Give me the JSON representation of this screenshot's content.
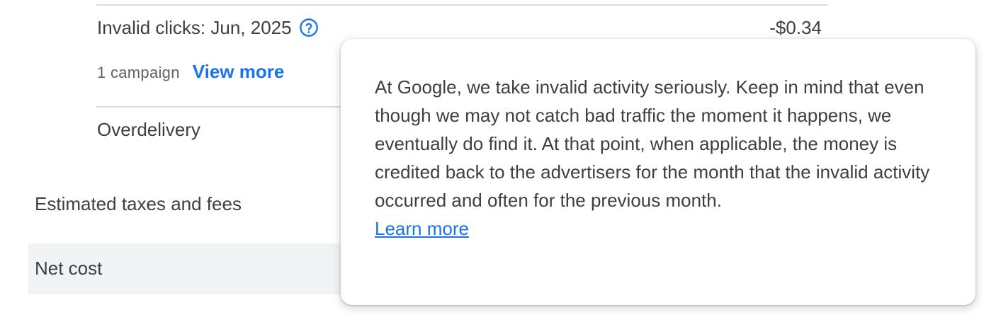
{
  "invalid_clicks": {
    "label": "Invalid clicks: Jun, 2025",
    "help_icon": "help-circle-icon",
    "amount": "-$0.34",
    "campaign_count": "1 campaign",
    "view_more": "View more"
  },
  "rows": {
    "overdelivery": "Overdelivery",
    "taxes": "Estimated taxes and fees",
    "net_cost": "Net cost"
  },
  "tooltip": {
    "body": "At Google, we take invalid activity seriously. Keep in mind that even though we may not catch bad traffic the moment it happens, we eventually do find it. At that point, when applicable, the money is credited back to the advertisers for the month that the invalid activity occurred and often for the previous month.",
    "learn_more": "Learn more"
  },
  "colors": {
    "accent": "#1a73e8",
    "text": "#3c4043",
    "net_cost_band": "#f1f3f4"
  }
}
